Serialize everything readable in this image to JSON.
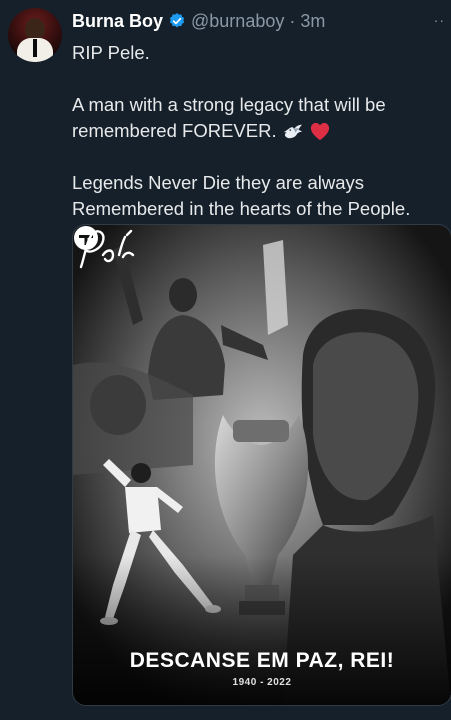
{
  "tweet": {
    "author_name": "Burna Boy",
    "handle": "@burnaboy",
    "separator": "·",
    "time": "3m",
    "more": "··",
    "lines": [
      "RIP Pele.",
      "A man with a strong legacy that will be",
      "remembered FOREVER.",
      "Legends Never Die they are always",
      "Remembered in the hearts of the People."
    ]
  },
  "media": {
    "headline": "DESCANSE EM PAZ, REI!",
    "years": "1940 - 2022",
    "signature_text": "Pelé"
  },
  "colors": {
    "background": "#15202b",
    "verified_blue": "#1d9bf0",
    "secondary_text": "#8b98a5"
  },
  "icons": [
    "verified-badge-icon",
    "dove-emoji-icon",
    "red-heart-emoji-icon",
    "more-options-icon",
    "brand-logo-icon"
  ]
}
